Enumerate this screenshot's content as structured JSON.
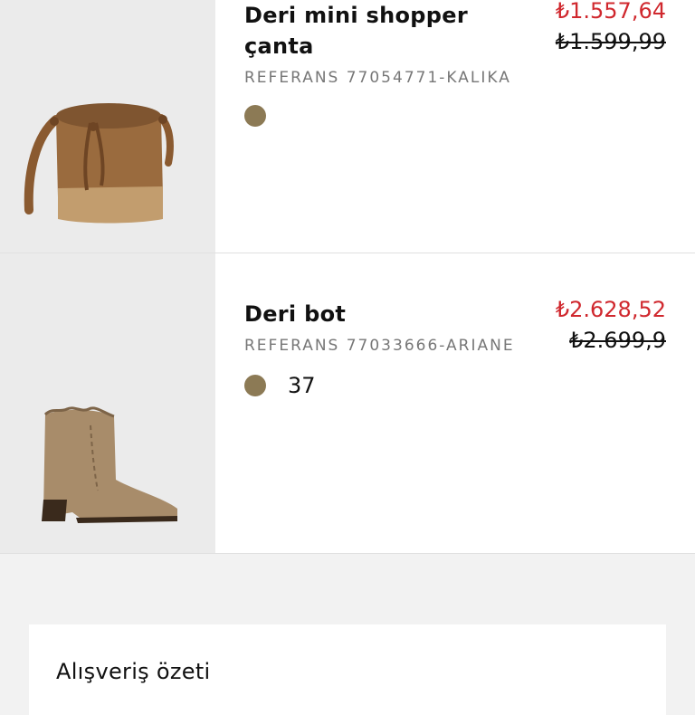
{
  "cart": {
    "items": [
      {
        "title": "Deri mini shopper çanta",
        "reference": "REFERANS 77054771-KALIKA",
        "color": "#8c7a55",
        "size": "",
        "price_new": "₺1.557,64",
        "price_old": "₺1.599,99"
      },
      {
        "title": "Deri bot",
        "reference": "REFERANS 77033666-ARIANE",
        "color": "#8c7a55",
        "size": "37",
        "price_new": "₺2.628,52",
        "price_old": "₺2.699,9"
      }
    ]
  },
  "summary": {
    "title": "Alışveriş özeti"
  }
}
